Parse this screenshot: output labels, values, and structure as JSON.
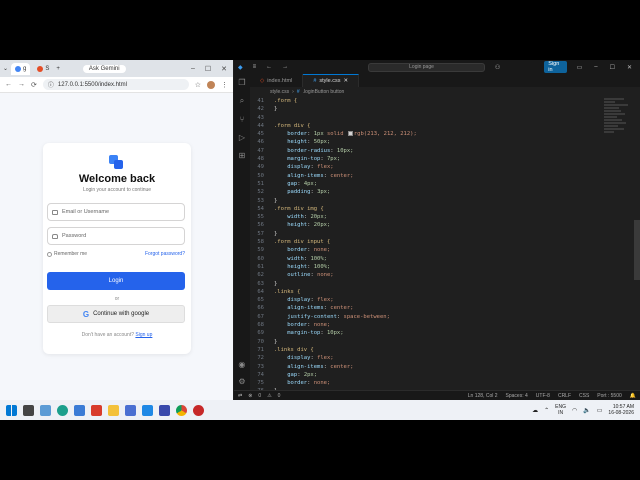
{
  "browser": {
    "tabs": [
      {
        "label": "g",
        "fav_color": "#4285f4"
      },
      {
        "label": "S",
        "fav_color": "#e44d26"
      }
    ],
    "new_tab": "+",
    "gemini_label": "Ask Gemini",
    "url": "127.0.0.1:5500/index.html"
  },
  "login_card": {
    "title": "Welcome back",
    "subtitle": "Login your account to continue",
    "email_placeholder": "Email or Username",
    "password_placeholder": "Password",
    "remember_label": "Remember me",
    "forgot_label": "Forgot password?",
    "login_label": "Login",
    "or_label": "or",
    "google_label": "Continue with google",
    "no_account_text": "Don't have an account?",
    "signup_label": "Sign up",
    "accent": "#2563eb"
  },
  "vscode": {
    "search_text": "Login page",
    "signin_label": "Sign in",
    "tabs": [
      {
        "label": "index.html",
        "kind": "html"
      },
      {
        "label": "style.css",
        "kind": "css"
      }
    ],
    "breadcrumb": [
      "style.css",
      "#",
      ".loginButton button"
    ],
    "status": {
      "errors": "0",
      "warnings": "0",
      "position": "Ln 128, Col 2",
      "spaces": "Spaces: 4",
      "encoding": "UTF-8",
      "eol": "CRLF",
      "language": "CSS",
      "port": "Port : 5500"
    },
    "lines": [
      {
        "n": "41",
        "parts": [
          {
            "t": ".form {",
            "c": "sel"
          }
        ]
      },
      {
        "n": "42",
        "parts": [
          {
            "t": "}",
            "c": "code"
          }
        ]
      },
      {
        "n": "43",
        "parts": [
          {
            "t": "",
            "c": "code"
          }
        ]
      },
      {
        "n": "44",
        "parts": [
          {
            "t": ".form div {",
            "c": "sel"
          }
        ]
      },
      {
        "n": "45",
        "parts": [
          {
            "t": "    border",
            "c": "prop"
          },
          {
            "t": ": ",
            "c": "code"
          },
          {
            "t": "1px",
            "c": "num"
          },
          {
            "t": " solid ",
            "c": "val"
          },
          {
            "t": "SWATCH",
            "c": "swatch"
          },
          {
            "t": "rgb(213, 212, 212);",
            "c": "val"
          }
        ]
      },
      {
        "n": "46",
        "parts": [
          {
            "t": "    height",
            "c": "prop"
          },
          {
            "t": ": ",
            "c": "code"
          },
          {
            "t": "50px;",
            "c": "num"
          }
        ]
      },
      {
        "n": "47",
        "parts": [
          {
            "t": "    border-radius",
            "c": "prop"
          },
          {
            "t": ": ",
            "c": "code"
          },
          {
            "t": "10px;",
            "c": "num"
          }
        ]
      },
      {
        "n": "48",
        "parts": [
          {
            "t": "    margin-top",
            "c": "prop"
          },
          {
            "t": ": ",
            "c": "code"
          },
          {
            "t": "7px;",
            "c": "num"
          }
        ]
      },
      {
        "n": "49",
        "parts": [
          {
            "t": "    display",
            "c": "prop"
          },
          {
            "t": ": ",
            "c": "code"
          },
          {
            "t": "flex;",
            "c": "val"
          }
        ]
      },
      {
        "n": "50",
        "parts": [
          {
            "t": "    align-items",
            "c": "prop"
          },
          {
            "t": ": ",
            "c": "code"
          },
          {
            "t": "center;",
            "c": "val"
          }
        ]
      },
      {
        "n": "51",
        "parts": [
          {
            "t": "    gap",
            "c": "prop"
          },
          {
            "t": ": ",
            "c": "code"
          },
          {
            "t": "4px;",
            "c": "num"
          }
        ]
      },
      {
        "n": "52",
        "parts": [
          {
            "t": "    padding",
            "c": "prop"
          },
          {
            "t": ": ",
            "c": "code"
          },
          {
            "t": "3px;",
            "c": "num"
          }
        ]
      },
      {
        "n": "53",
        "parts": [
          {
            "t": "}",
            "c": "code"
          }
        ]
      },
      {
        "n": "54",
        "parts": [
          {
            "t": ".form div img {",
            "c": "sel"
          }
        ]
      },
      {
        "n": "55",
        "parts": [
          {
            "t": "    width",
            "c": "prop"
          },
          {
            "t": ": ",
            "c": "code"
          },
          {
            "t": "20px;",
            "c": "num"
          }
        ]
      },
      {
        "n": "56",
        "parts": [
          {
            "t": "    height",
            "c": "prop"
          },
          {
            "t": ": ",
            "c": "code"
          },
          {
            "t": "20px;",
            "c": "num"
          }
        ]
      },
      {
        "n": "57",
        "parts": [
          {
            "t": "}",
            "c": "code"
          }
        ]
      },
      {
        "n": "58",
        "parts": [
          {
            "t": ".form div input {",
            "c": "sel"
          }
        ]
      },
      {
        "n": "59",
        "parts": [
          {
            "t": "    border",
            "c": "prop"
          },
          {
            "t": ": ",
            "c": "code"
          },
          {
            "t": "none;",
            "c": "val"
          }
        ]
      },
      {
        "n": "60",
        "parts": [
          {
            "t": "    width",
            "c": "prop"
          },
          {
            "t": ": ",
            "c": "code"
          },
          {
            "t": "100%;",
            "c": "num"
          }
        ]
      },
      {
        "n": "61",
        "parts": [
          {
            "t": "    height",
            "c": "prop"
          },
          {
            "t": ": ",
            "c": "code"
          },
          {
            "t": "100%;",
            "c": "num"
          }
        ]
      },
      {
        "n": "62",
        "parts": [
          {
            "t": "    outline",
            "c": "prop"
          },
          {
            "t": ": ",
            "c": "code"
          },
          {
            "t": "none;",
            "c": "val"
          }
        ]
      },
      {
        "n": "63",
        "parts": [
          {
            "t": "}",
            "c": "code"
          }
        ]
      },
      {
        "n": "64",
        "parts": [
          {
            "t": ".links {",
            "c": "sel"
          }
        ]
      },
      {
        "n": "65",
        "parts": [
          {
            "t": "    display",
            "c": "prop"
          },
          {
            "t": ": ",
            "c": "code"
          },
          {
            "t": "flex;",
            "c": "val"
          }
        ]
      },
      {
        "n": "66",
        "parts": [
          {
            "t": "    align-items",
            "c": "prop"
          },
          {
            "t": ": ",
            "c": "code"
          },
          {
            "t": "center;",
            "c": "val"
          }
        ]
      },
      {
        "n": "67",
        "parts": [
          {
            "t": "    justify-content",
            "c": "prop"
          },
          {
            "t": ": ",
            "c": "code"
          },
          {
            "t": "space-between;",
            "c": "val"
          }
        ]
      },
      {
        "n": "68",
        "parts": [
          {
            "t": "    border",
            "c": "prop"
          },
          {
            "t": ": ",
            "c": "code"
          },
          {
            "t": "none;",
            "c": "val"
          }
        ]
      },
      {
        "n": "69",
        "parts": [
          {
            "t": "    margin-top",
            "c": "prop"
          },
          {
            "t": ": ",
            "c": "code"
          },
          {
            "t": "10px;",
            "c": "num"
          }
        ]
      },
      {
        "n": "70",
        "parts": [
          {
            "t": "}",
            "c": "code"
          }
        ]
      },
      {
        "n": "71",
        "parts": [
          {
            "t": ".links div {",
            "c": "sel"
          }
        ]
      },
      {
        "n": "72",
        "parts": [
          {
            "t": "    display",
            "c": "prop"
          },
          {
            "t": ": ",
            "c": "code"
          },
          {
            "t": "flex;",
            "c": "val"
          }
        ]
      },
      {
        "n": "73",
        "parts": [
          {
            "t": "    align-items",
            "c": "prop"
          },
          {
            "t": ": ",
            "c": "code"
          },
          {
            "t": "center;",
            "c": "val"
          }
        ]
      },
      {
        "n": "74",
        "parts": [
          {
            "t": "    gap",
            "c": "prop"
          },
          {
            "t": ": ",
            "c": "code"
          },
          {
            "t": "2px;",
            "c": "num"
          }
        ]
      },
      {
        "n": "75",
        "parts": [
          {
            "t": "    border",
            "c": "prop"
          },
          {
            "t": ": ",
            "c": "code"
          },
          {
            "t": "none;",
            "c": "val"
          }
        ]
      },
      {
        "n": "76",
        "parts": [
          {
            "t": "}",
            "c": "code"
          }
        ]
      }
    ]
  },
  "taskbar": {
    "lang_top": "ENG",
    "lang_bottom": "IN",
    "time": "10:57 AM",
    "date": "16-08-2026"
  }
}
